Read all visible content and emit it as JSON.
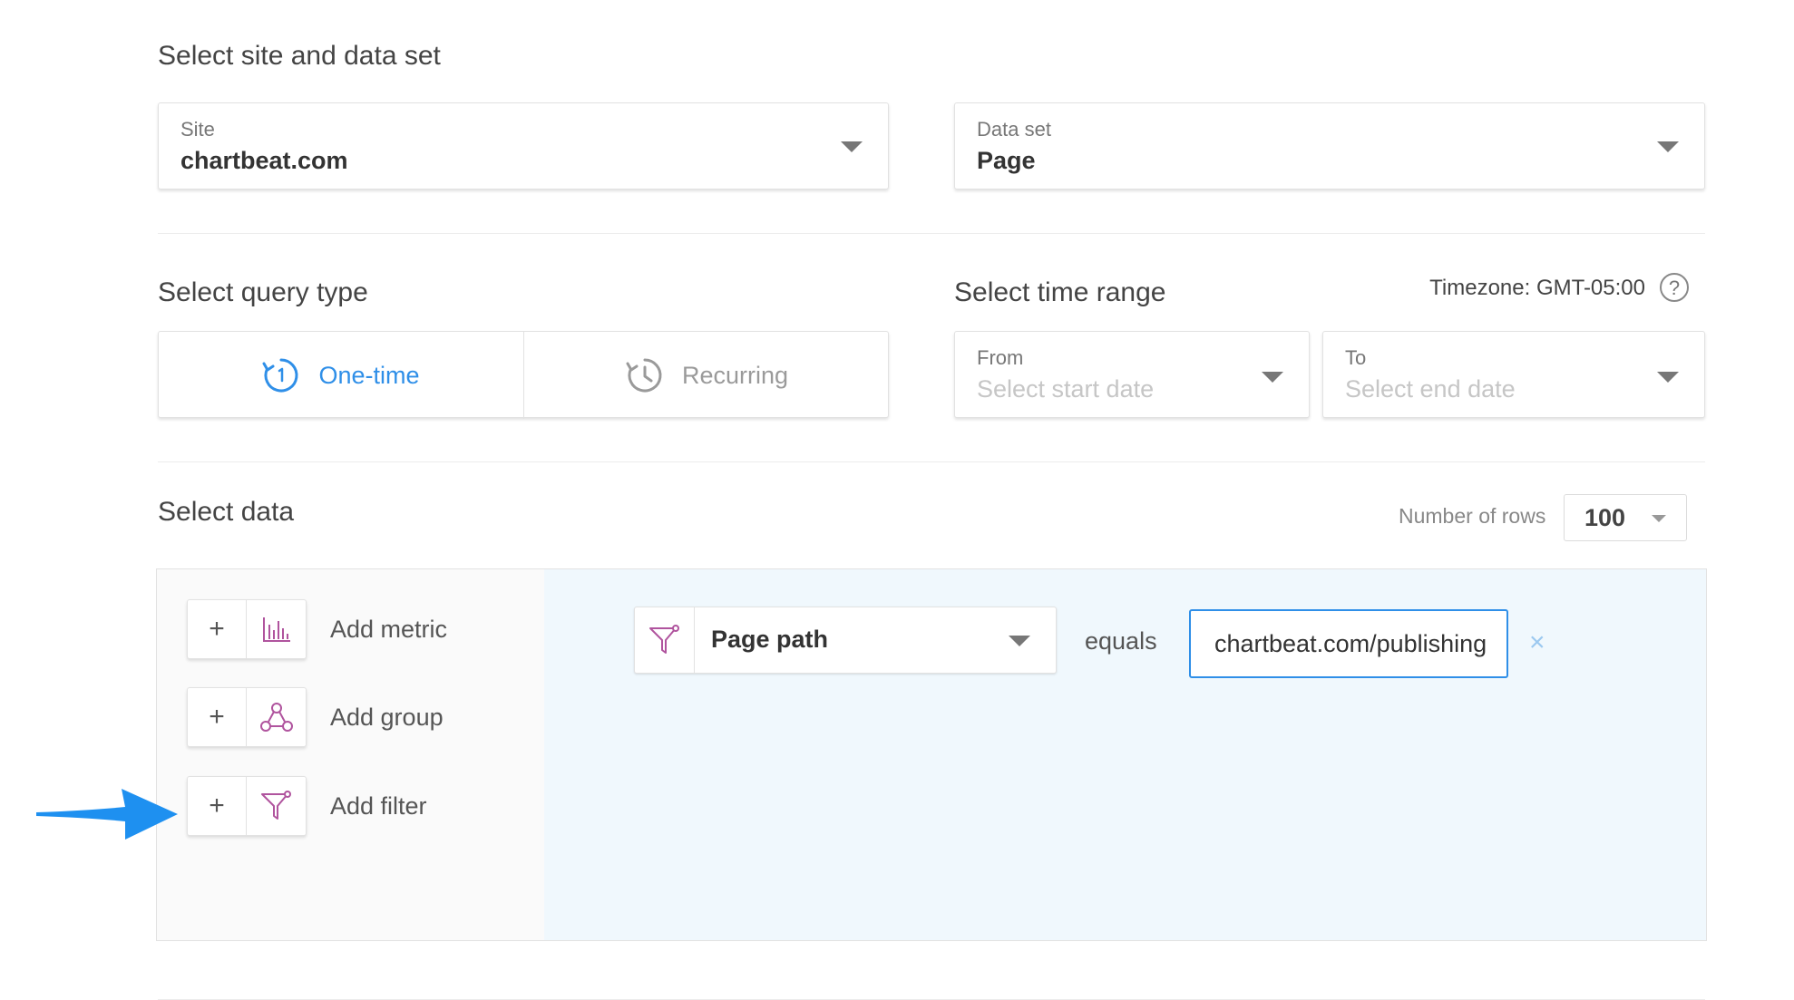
{
  "site_section": {
    "title": "Select site and data set",
    "site": {
      "label": "Site",
      "value": "chartbeat.com"
    },
    "data_set": {
      "label": "Data set",
      "value": "Page"
    }
  },
  "query_type": {
    "title": "Select query type",
    "tabs": [
      {
        "label": "One-time",
        "icon": "one-time-clock-icon",
        "selected": true
      },
      {
        "label": "Recurring",
        "icon": "recurring-clock-icon",
        "selected": false
      }
    ]
  },
  "time_range": {
    "title": "Select time range",
    "timezone": "Timezone: GMT-05:00",
    "help": "?",
    "from": {
      "label": "From",
      "placeholder": "Select start date"
    },
    "to": {
      "label": "To",
      "placeholder": "Select end date"
    }
  },
  "select_data": {
    "title": "Select data",
    "rows_label": "Number of rows",
    "rows_value": "100",
    "actions": [
      {
        "label": "Add metric",
        "icon": "bar-chart-icon",
        "plus": "+"
      },
      {
        "label": "Add group",
        "icon": "group-nodes-icon",
        "plus": "+"
      },
      {
        "label": "Add filter",
        "icon": "filter-icon",
        "plus": "+"
      }
    ],
    "filter": {
      "field": "Page path",
      "operator": "equals",
      "value": "chartbeat.com/publishing",
      "remove": "×"
    }
  },
  "colors": {
    "accent_blue": "#2f8fe8",
    "icon_purple": "#b0549e",
    "filter_panel_bg": "#f0f8fd",
    "arrow_blue": "#1e90f0"
  }
}
